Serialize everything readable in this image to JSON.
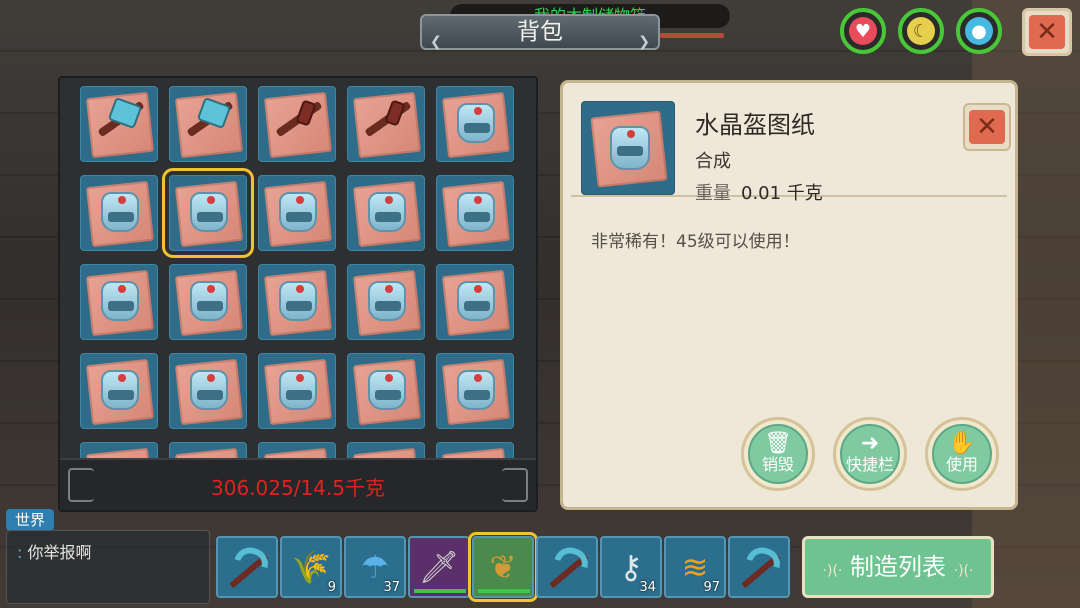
{
  "header": {
    "title": "背包",
    "container_label": "我的木制储物箱"
  },
  "status": {
    "health_icon": "heart-icon",
    "hunger_icon": "banana-icon",
    "water_icon": "droplet-icon",
    "accent_green": "#49c837"
  },
  "inventory": {
    "weight_text": "306.025/14.5千克",
    "weight_color": "#e0231f",
    "rows": [
      [
        "pickaxe",
        "pickaxe",
        "bow",
        "bow",
        "helmet-blueprint"
      ],
      [
        "helmet-blueprint",
        "helmet-blueprint",
        "helmet-blueprint",
        "helmet-blueprint",
        "helmet-blueprint"
      ],
      [
        "helmet-blueprint",
        "helmet-blueprint",
        "helmet-blueprint",
        "helmet-blueprint",
        "helmet-blueprint"
      ],
      [
        "helmet-blueprint",
        "helmet-blueprint",
        "helmet-blueprint",
        "helmet-blueprint",
        "helmet-blueprint"
      ],
      [
        "helmet-blueprint",
        "helmet-blueprint",
        "helmet-blueprint",
        "helmet-blueprint",
        "helmet-blueprint"
      ]
    ],
    "selected": {
      "row": 1,
      "col": 1
    }
  },
  "detail": {
    "name": "水晶盔图纸",
    "type": "合成",
    "weight_label": "重量",
    "weight_value": "0.01 千克",
    "description": "非常稀有！45级可以使用！",
    "actions": {
      "discard": "销毁",
      "shortcut": "快捷栏",
      "use": "使用"
    }
  },
  "chat": {
    "channel": "世界",
    "message_prefix": ":",
    "message": "你举报啊"
  },
  "hotbar": {
    "items": [
      {
        "icon": "pickaxe-icon",
        "count": ""
      },
      {
        "icon": "seed-bag-icon",
        "count": "9"
      },
      {
        "icon": "umbrella-icon",
        "count": "37"
      },
      {
        "icon": "sword-icon",
        "count": ""
      },
      {
        "icon": "banana-pouch-icon",
        "count": ""
      },
      {
        "icon": "pickaxe-icon",
        "count": ""
      },
      {
        "icon": "keyring-icon",
        "count": "34"
      },
      {
        "icon": "fries-icon",
        "count": "97"
      },
      {
        "icon": "pickaxe-icon",
        "count": ""
      }
    ],
    "active_index": 4
  },
  "craft_button": "制造列表"
}
